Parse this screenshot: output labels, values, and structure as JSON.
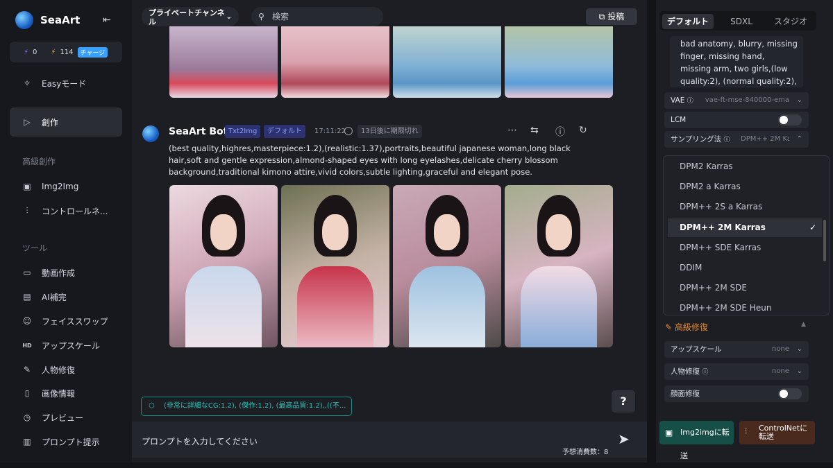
{
  "sidebar": {
    "brand": "SeaArt",
    "credits": {
      "energy": "0",
      "bolts": "114",
      "charge": "チャージ"
    },
    "items": [
      {
        "label": "Easyモード",
        "icon": "sparkle-icon"
      },
      {
        "label": "創作",
        "icon": "play-icon"
      }
    ],
    "section_advanced": "高級創作",
    "advanced_items": [
      {
        "label": "Img2Img"
      },
      {
        "label": "コントロールネ..."
      }
    ],
    "section_tools": "ツール",
    "tool_items": [
      {
        "label": "動画作成"
      },
      {
        "label": "AI補完"
      },
      {
        "label": "フェイススワップ"
      },
      {
        "label": "アップスケール"
      },
      {
        "label": "人物修復"
      },
      {
        "label": "画像情報"
      },
      {
        "label": "プレビュー"
      },
      {
        "label": "プロンプト提示"
      }
    ]
  },
  "header": {
    "channel": "プライベートチャンネル",
    "search_placeholder": "検索",
    "post_label": "投稿"
  },
  "message": {
    "bot_name": "SeaArt Bot",
    "tags": [
      "Txt2Img",
      "デフォルト"
    ],
    "time": "17:11:22",
    "expiry": "13日後に期限切れ",
    "prompt": "(best quality,highres,masterpiece:1.2),(realistic:1.37),portraits,beautiful japanese woman,long black hair,soft and gentle expression,almond-shaped eyes with long eyelashes,delicate cherry blossom background,traditional kimono attire,vivid colors,subtle lighting,graceful and elegant pose."
  },
  "chip_text": "(非常に詳細なCG:1.2), (傑作:1.2), (最高品質:1.2),,((不...",
  "help_label": "?",
  "composer": {
    "placeholder": "プロンプトを入力してください",
    "cost": "予想消費数：8"
  },
  "panel": {
    "tabs": [
      "デフォルト",
      "SDXL",
      "スタジオ"
    ],
    "negative_prompt": "bad anatomy, blurry, missing finger, missing hand, missing arm, two girls,(low quality:2), (normal quality:2),",
    "vae_label": "VAE",
    "vae_value": "vae-ft-mse-840000-ema",
    "lcm_label": "LCM",
    "sampler_label": "サンプリング法",
    "sampler_value": "DPM++ 2M Karras",
    "sampler_options": [
      "DPM2 Karras",
      "DPM2 a Karras",
      "DPM++ 2S a Karras",
      "DPM++ 2M Karras",
      "DPM++ SDE Karras",
      "DDIM",
      "DPM++ 2M SDE",
      "DPM++ 2M SDE Heun"
    ],
    "selected_check": "✓",
    "fix_section": "高級修復",
    "upscale_label": "アップスケール",
    "upscale_value": "none",
    "portrait_fix_label": "人物修復",
    "portrait_fix_value": "none",
    "face_fix_label": "顔面修復",
    "img2img_button": "Img2imgに転送",
    "controlnet_button": "ControlNetに転送"
  },
  "colors": {
    "accent_teal": "#2fc4b8",
    "accent_orange": "#e08a3b",
    "tag_blue": "#8fa3ff"
  }
}
